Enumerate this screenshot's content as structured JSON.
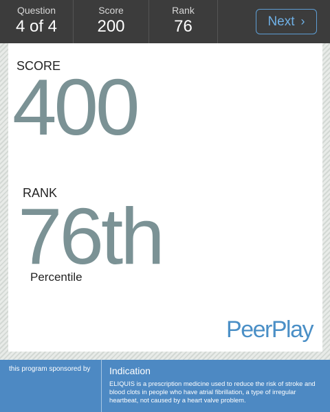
{
  "header": {
    "question": {
      "label": "Question",
      "value": "4 of 4"
    },
    "score": {
      "label": "Score",
      "value": "200"
    },
    "rank": {
      "label": "Rank",
      "value": "76"
    },
    "next_label": "Next",
    "next_icon": "chevron-right-icon",
    "next_chevron": "›"
  },
  "result": {
    "score_label": "SCORE",
    "score_value": "400",
    "rank_label": "RANK",
    "rank_value": "76th",
    "percentile_label": "Percentile"
  },
  "brand": "PeerPlay",
  "footer": {
    "sponsor_text": "this program sponsored by",
    "indication_title": "Indication",
    "indication_text": "ELIQUIS is a prescription medicine used to reduce the risk of stroke and blood clots in people who have atrial fibrillation, a type of irregular heartbeat, not caused by a heart valve problem."
  },
  "colors": {
    "header_bg": "#3c3c3c",
    "accent_blue": "#4a8fc6",
    "big_number": "#7b9295",
    "footer_bg": "#4d89c3"
  }
}
